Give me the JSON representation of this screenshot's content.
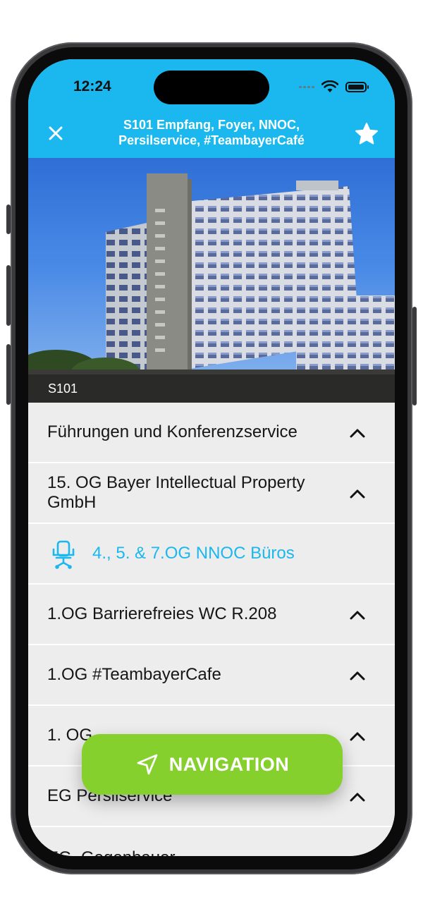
{
  "status_bar": {
    "time": "12:24"
  },
  "header": {
    "title_line1": "S101 Empfang, Foyer, NNOC,",
    "title_line2": "Persilservice, #TeambayerCafé",
    "close_icon": "close-icon",
    "favorite_icon": "star-icon"
  },
  "hero": {
    "caption": "S101"
  },
  "list": {
    "items": [
      {
        "label": "Führungen und Konferenzservice",
        "type": "expandable"
      },
      {
        "label": "15. OG Bayer Intellectual Property GmbH",
        "type": "expandable"
      },
      {
        "label": "4., 5. & 7.OG NNOC Büros",
        "type": "link",
        "icon": "office-chair-icon"
      },
      {
        "label": "1.OG Barrierefreies WC R.208",
        "type": "expandable"
      },
      {
        "label": "1.OG #TeambayerCafe",
        "type": "expandable"
      },
      {
        "label": "1. OG",
        "type": "expandable"
      },
      {
        "label": "EG Persilservice",
        "type": "expandable"
      },
      {
        "label": "EG, Gegenbauer",
        "type": "expandable"
      }
    ]
  },
  "navigation_button": {
    "label": "NAVIGATION",
    "icon": "navigation-arrow-icon"
  },
  "colors": {
    "header": "#1ab8ef",
    "accent": "#1ab8ef",
    "nav_button": "#86d02e",
    "list_bg": "#ededed"
  }
}
